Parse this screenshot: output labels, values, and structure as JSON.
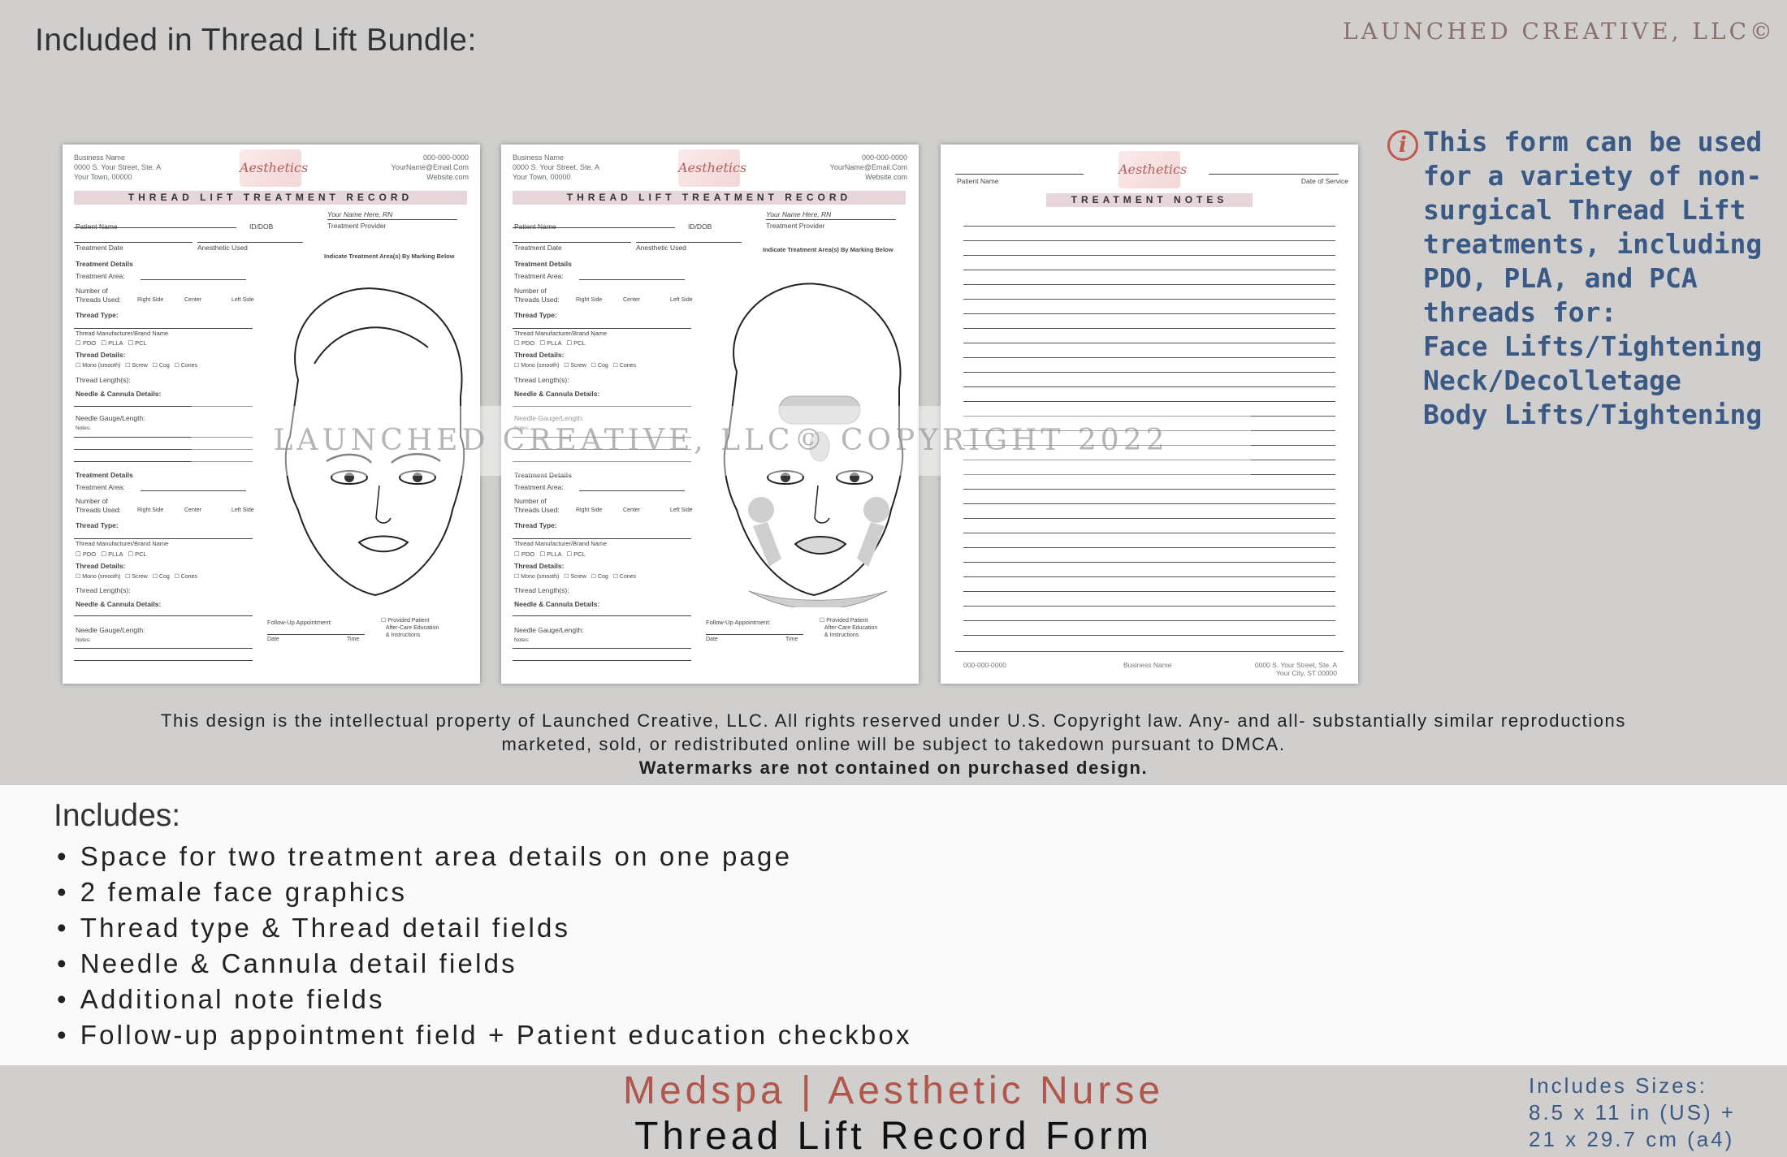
{
  "header": {
    "bundle_title": "Included in Thread Lift Bundle:",
    "brand": "LAUNCHED CREATIVE, LLC©"
  },
  "form": {
    "business_name": "Business Name",
    "street": "0000 S. Your Street, Ste. A",
    "town": "Your Town, 00000",
    "phone": "000-000-0000",
    "email": "YourName@Email.Com",
    "website": "Website.com",
    "logo_text": "Aesthetics",
    "title": "THREAD LIFT TREATMENT RECORD",
    "patient_name": "Patient Name",
    "id_dob": "ID/DOB",
    "provider_name": "Your Name Here, RN",
    "treatment_provider": "Treatment Provider",
    "treatment_date": "Treatment Date",
    "anesthetic": "Anesthetic Used",
    "indicate": "Indicate Treatment Area(s) By Marking Below",
    "treatment_details": "Treatment Details",
    "treatment_area": "Treatment Area:",
    "number_of": "Number of",
    "threads_used": "Threads Used:",
    "right_side": "Right Side",
    "center": "Center",
    "left_side": "Left Side",
    "thread_type": "Thread Type:",
    "manufacturer": "Thread Manufacturer/Brand Name",
    "pdo": "PDO",
    "plla": "PLLA",
    "pcl": "PCL",
    "thread_details": "Thread Details:",
    "mono": "Mono (smooth)",
    "screw": "Screw",
    "cog": "Cog",
    "cones": "Cones",
    "thread_length": "Thread Length(s):",
    "needle_cannula": "Needle & Cannula Details:",
    "needle_gauge": "Needle Gauge/Length:",
    "notes": "Notes:",
    "follow_up": "Follow-Up Appointment:",
    "date": "Date",
    "time": "Time",
    "provided_patient": "Provided Patient",
    "after_care": "After-Care Education",
    "instructions": "& Instructions"
  },
  "notes_page": {
    "patient_name": "Patient Name",
    "date_of_service": "Date of Service",
    "title": "TREATMENT NOTES",
    "footer_phone": "000-000-0000",
    "footer_business": "Business Name",
    "footer_street": "0000 S. Your Street, Ste. A",
    "footer_city": "Your City, ST 00000"
  },
  "watermark": "LAUNCHED CREATIVE, LLC© COPYRIGHT 2022",
  "info": {
    "icon": "info-icon",
    "lines": [
      "This form can be used",
      "for a variety of non-",
      "surgical Thread Lift",
      "treatments, including",
      "PDO, PLA, and PCA",
      "threads for:",
      "Face Lifts/Tightening",
      "Neck/Decolletage",
      "Body Lifts/Tightening"
    ]
  },
  "copyright": {
    "line1": "This design is the intellectual property of Launched Creative, LLC. All rights reserved under U.S. Copyright law. Any- and all- substantially similar reproductions",
    "line2": "marketed, sold, or redistributed online will be subject to takedown pursuant to DMCA.",
    "line3": "Watermarks are not contained on purchased design."
  },
  "includes": {
    "title": "Includes:",
    "items": [
      "Space for two treatment area details on one page",
      "2 female face graphics",
      "Thread type & Thread detail fields",
      "Needle & Cannula detail fields",
      "Additional note fields",
      "Follow-up appointment field + Patient education checkbox"
    ]
  },
  "footer": {
    "category": "Medspa | Aesthetic Nurse",
    "form_name": "Thread Lift Record Form",
    "sizes_label": "Includes Sizes:",
    "size_us": "8.5 x 11 in (US) +",
    "size_a4": "21 x 29.7 cm (a4)"
  },
  "colors": {
    "background_gray": "#d0cfcd",
    "accent_red": "#b0564a",
    "accent_blue": "#3a5a85",
    "banner_pink": "#e6d6da"
  }
}
